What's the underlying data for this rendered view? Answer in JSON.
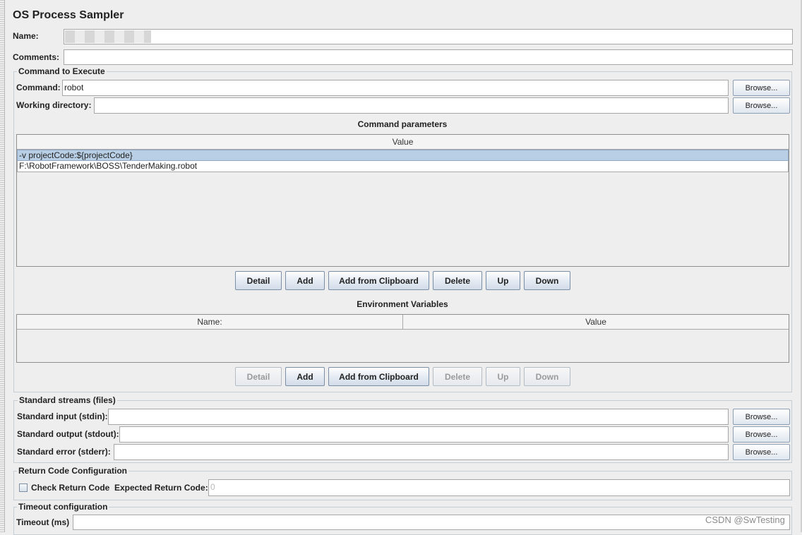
{
  "panel": {
    "title": "OS Process Sampler",
    "name_label": "Name:",
    "name_value": "",
    "comments_label": "Comments:",
    "comments_value": ""
  },
  "command_section": {
    "legend": "Command to Execute",
    "command_label": "Command:",
    "command_value": "robot",
    "workdir_label": "Working directory:",
    "workdir_value": "",
    "browse_label": "Browse..."
  },
  "command_parameters": {
    "title": "Command parameters",
    "column_header": "Value",
    "rows": [
      {
        "value": "-v projectCode:${projectCode}",
        "selected": true
      },
      {
        "value": "F:\\RobotFramework\\BOSS\\TenderMaking.robot",
        "selected": false
      }
    ],
    "buttons": {
      "detail": "Detail",
      "add": "Add",
      "add_clipboard": "Add from Clipboard",
      "delete": "Delete",
      "up": "Up",
      "down": "Down"
    }
  },
  "environment_variables": {
    "title": "Environment Variables",
    "col_name": "Name:",
    "col_value": "Value",
    "buttons": {
      "detail": "Detail",
      "add": "Add",
      "add_clipboard": "Add from Clipboard",
      "delete": "Delete",
      "up": "Up",
      "down": "Down"
    }
  },
  "streams": {
    "legend": "Standard streams (files)",
    "stdin_label": "Standard input (stdin):",
    "stdout_label": "Standard output (stdout):",
    "stderr_label": "Standard error (stderr):",
    "browse_label": "Browse..."
  },
  "return_code": {
    "legend": "Return Code Configuration",
    "check_label": "Check Return Code",
    "checked": false,
    "expected_label": "Expected Return Code:",
    "expected_value": "0"
  },
  "timeout": {
    "legend": "Timeout configuration",
    "label": "Timeout (ms)",
    "value": ""
  },
  "watermark": "CSDN @SwTesting",
  "colors": {
    "background": "#eeeeee",
    "selected_row": "#b9cfe5",
    "disabled_text": "#9a9a9a"
  }
}
